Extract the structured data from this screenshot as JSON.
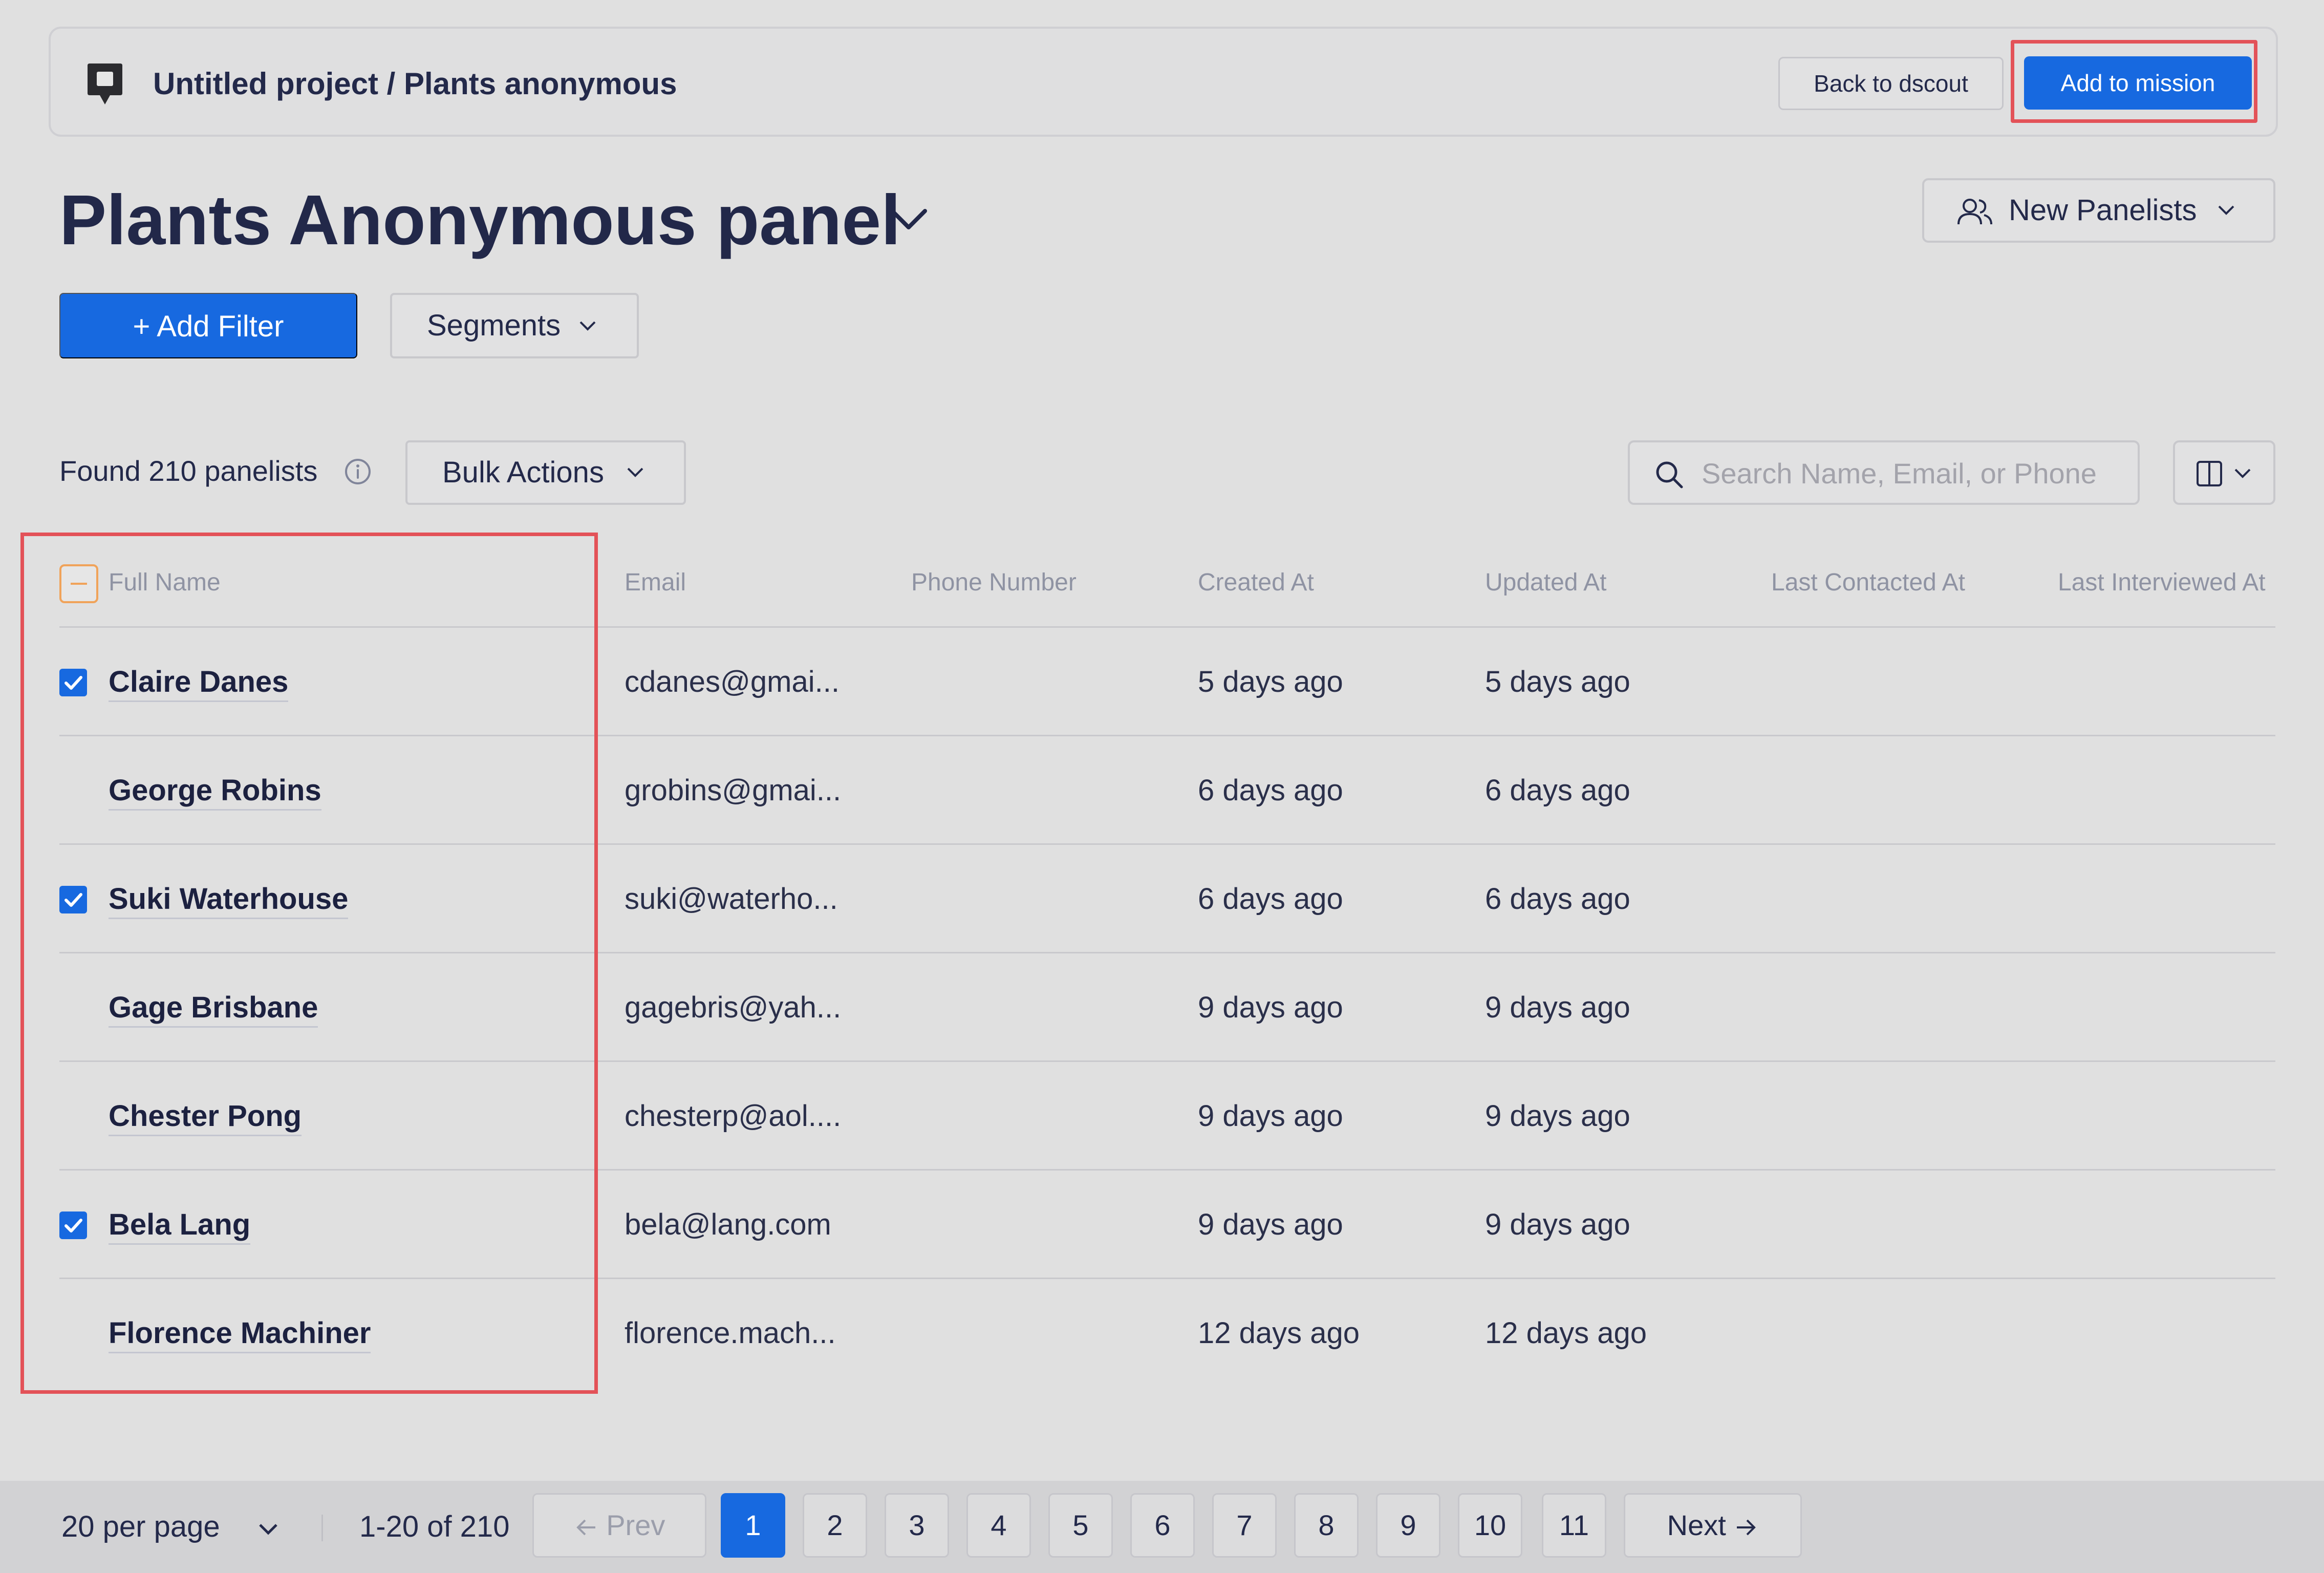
{
  "header": {
    "breadcrumb": "Untitled project / Plants anonymous",
    "back_label": "Back to dscout",
    "add_mission_label": "Add to mission"
  },
  "title": {
    "text": "Plants Anonymous panel",
    "new_panelists_label": "New Panelists"
  },
  "filters": {
    "add_filter_label": "+ Add Filter",
    "segments_label": "Segments"
  },
  "results": {
    "found_text": "Found 210 panelists",
    "bulk_actions_label": "Bulk Actions",
    "search_placeholder": "Search Name, Email, or Phone",
    "search_value": ""
  },
  "table": {
    "columns": [
      "Full Name",
      "Email",
      "Phone Number",
      "Created At",
      "Updated At",
      "Last Contacted At",
      "Last Interviewed At"
    ],
    "rows": [
      {
        "name": "Claire Danes",
        "email": "cdanes@gmai...",
        "phone": "",
        "created": "5 days ago",
        "updated": "5 days ago",
        "checked": true
      },
      {
        "name": "George Robins",
        "email": "grobins@gmai...",
        "phone": "",
        "created": "6 days ago",
        "updated": "6 days ago",
        "checked": false
      },
      {
        "name": "Suki Waterhouse",
        "email": "suki@waterho...",
        "phone": "",
        "created": "6 days ago",
        "updated": "6 days ago",
        "checked": true
      },
      {
        "name": "Gage Brisbane",
        "email": "gagebris@yah...",
        "phone": "",
        "created": "9 days ago",
        "updated": "9 days ago",
        "checked": false
      },
      {
        "name": "Chester Pong",
        "email": "chesterp@aol....",
        "phone": "",
        "created": "9 days ago",
        "updated": "9 days ago",
        "checked": false
      },
      {
        "name": "Bela Lang",
        "email": "bela@lang.com",
        "phone": "",
        "created": "9 days ago",
        "updated": "9 days ago",
        "checked": true
      },
      {
        "name": "Florence Machiner",
        "email": "florence.mach...",
        "phone": "",
        "created": "12 days ago",
        "updated": "12 days ago",
        "checked": false
      }
    ]
  },
  "pagination": {
    "per_page_label": "20 per page",
    "range_text": "1-20 of 210",
    "prev_label": "Prev",
    "next_label": "Next",
    "pages": [
      "1",
      "2",
      "3",
      "4",
      "5",
      "6",
      "7",
      "8",
      "9",
      "10",
      "11"
    ],
    "current_page": "1"
  },
  "colors": {
    "accent": "#1769e0",
    "highlight": "#e35258",
    "background": "#e0e0e0"
  },
  "icons": {
    "logo": "chat-bubble-icon",
    "title_dropdown": "chevron-down-icon",
    "new_panelists": "people-icon",
    "info": "info-icon",
    "search": "search-icon",
    "columns": "columns-icon"
  }
}
